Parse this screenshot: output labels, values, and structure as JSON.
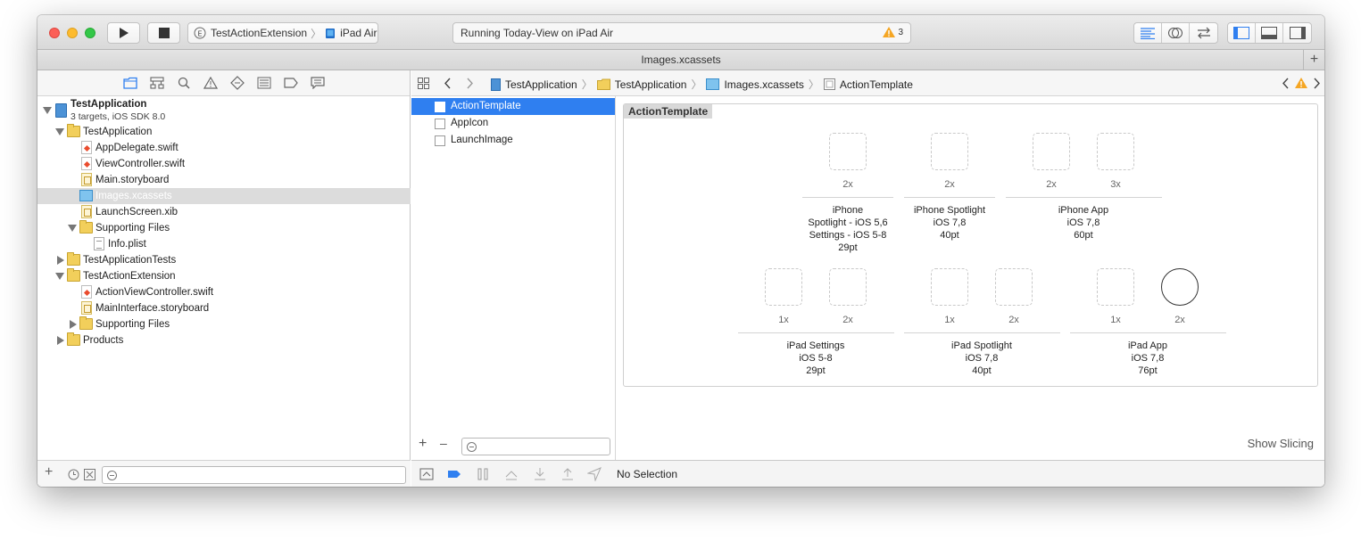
{
  "toolbar": {
    "scheme_target": "TestActionExtension",
    "scheme_device": "iPad Air",
    "status_text": "Running Today-View on iPad Air",
    "warning_count": "3"
  },
  "tab": {
    "title": "Images.xcassets",
    "plus": "+"
  },
  "navigator": {
    "items": [
      {
        "label": "TestApplication",
        "sub": "3 targets, iOS SDK 8.0",
        "type": "project"
      },
      {
        "label": "TestApplication",
        "type": "folder"
      },
      {
        "label": "AppDelegate.swift",
        "type": "swift"
      },
      {
        "label": "ViewController.swift",
        "type": "swift"
      },
      {
        "label": "Main.storyboard",
        "type": "storyboard"
      },
      {
        "label": "Images.xcassets",
        "type": "assets"
      },
      {
        "label": "LaunchScreen.xib",
        "type": "storyboard"
      },
      {
        "label": "Supporting Files",
        "type": "folder"
      },
      {
        "label": "Info.plist",
        "type": "plist"
      },
      {
        "label": "TestApplicationTests",
        "type": "folder"
      },
      {
        "label": "TestActionExtension",
        "type": "folder"
      },
      {
        "label": "ActionViewController.swift",
        "type": "swift"
      },
      {
        "label": "MainInterface.storyboard",
        "type": "storyboard"
      },
      {
        "label": "Supporting Files",
        "type": "folder"
      },
      {
        "label": "Products",
        "type": "folder"
      }
    ],
    "selected": "Images.xcassets",
    "footer_plus": "+"
  },
  "jumpbar": {
    "crumbs": [
      "TestApplication",
      "TestApplication",
      "Images.xcassets",
      "ActionTemplate"
    ]
  },
  "asset_sets": {
    "items": [
      "ActionTemplate",
      "AppIcon",
      "LaunchImage"
    ],
    "selected": "ActionTemplate",
    "plus": "+",
    "minus": "–"
  },
  "asset": {
    "title": "ActionTemplate",
    "groups": [
      {
        "scales": [
          "2x"
        ],
        "lines": [
          "iPhone",
          "Spotlight - iOS 5,6",
          "Settings - iOS 5-8",
          "29pt"
        ]
      },
      {
        "scales": [
          "2x"
        ],
        "lines": [
          "iPhone Spotlight",
          "iOS 7,8",
          "40pt"
        ]
      },
      {
        "scales": [
          "2x",
          "3x"
        ],
        "lines": [
          "iPhone App",
          "iOS 7,8",
          "60pt"
        ]
      },
      {
        "scales": [
          "1x",
          "2x"
        ],
        "lines": [
          "iPad Settings",
          "iOS 5-8",
          "29pt"
        ]
      },
      {
        "scales": [
          "1x",
          "2x"
        ],
        "lines": [
          "iPad Spotlight",
          "iOS 7,8",
          "40pt"
        ]
      },
      {
        "scales": [
          "1x",
          "2x"
        ],
        "lines": [
          "iPad App",
          "iOS 7,8",
          "76pt"
        ]
      }
    ],
    "show_slicing": "Show Slicing"
  },
  "debug": {
    "no_selection": "No Selection"
  },
  "colors": {
    "accent": "#2f7ff0",
    "folder": "#f2cf5b",
    "warning": "#f5a623"
  }
}
